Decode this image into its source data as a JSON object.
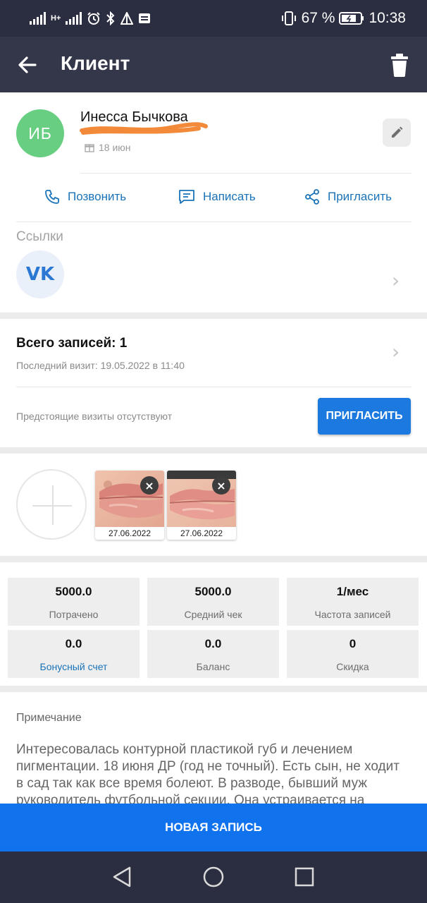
{
  "status_bar": {
    "network_label": "H+",
    "battery_percent": "67 %",
    "time": "10:38",
    "icons": [
      "signal-icon",
      "alarm-icon",
      "bluetooth-icon",
      "data-icon",
      "notification-icon",
      "vibrate-icon",
      "battery-icon"
    ]
  },
  "app_bar": {
    "title": "Клиент"
  },
  "client": {
    "initials": "ИБ",
    "name": "Инесса Бычкова",
    "birthday": "18 июн",
    "avatar_color": "#68cf82"
  },
  "actions": [
    {
      "label": "Позвонить",
      "icon": "phone-icon"
    },
    {
      "label": "Написать",
      "icon": "message-icon"
    },
    {
      "label": "Пригласить",
      "icon": "share-icon"
    }
  ],
  "links": {
    "title": "Ссылки",
    "vk_label": "VK"
  },
  "visits": {
    "title": "Всего записей: 1",
    "last_visit": "Последний визит: 19.05.2022 в 11:40",
    "upcoming": "Предстоящие визиты отсутствуют",
    "invite_label": "ПРИГЛАСИТЬ"
  },
  "photos": [
    {
      "date": "27.06.2022"
    },
    {
      "date": "27.06.2022"
    }
  ],
  "stats": [
    {
      "value": "5000.0",
      "label": "Потрачено"
    },
    {
      "value": "5000.0",
      "label": "Средний чек"
    },
    {
      "value": "1/мес",
      "label": "Частота записей"
    },
    {
      "value": "0.0",
      "label": "Бонусный счет"
    },
    {
      "value": "0.0",
      "label": "Баланс"
    },
    {
      "value": "0",
      "label": "Скидка"
    }
  ],
  "note": {
    "title": "Примечание",
    "text": "Интересовалась контурной пластикой губ и лечением пигментации. 18 июня ДР (год не точный). Есть сын, не ходит в сад так как все время болеют. В разводе, бывший муж руководитель футбольной секции. Она устраивается на"
  },
  "new_record_label": "НОВАЯ ЗАПИСЬ",
  "colors": {
    "accent": "#1172ee",
    "link": "#1a73b8",
    "app_bar": "#34364a",
    "status_bar": "#2b2d40"
  }
}
